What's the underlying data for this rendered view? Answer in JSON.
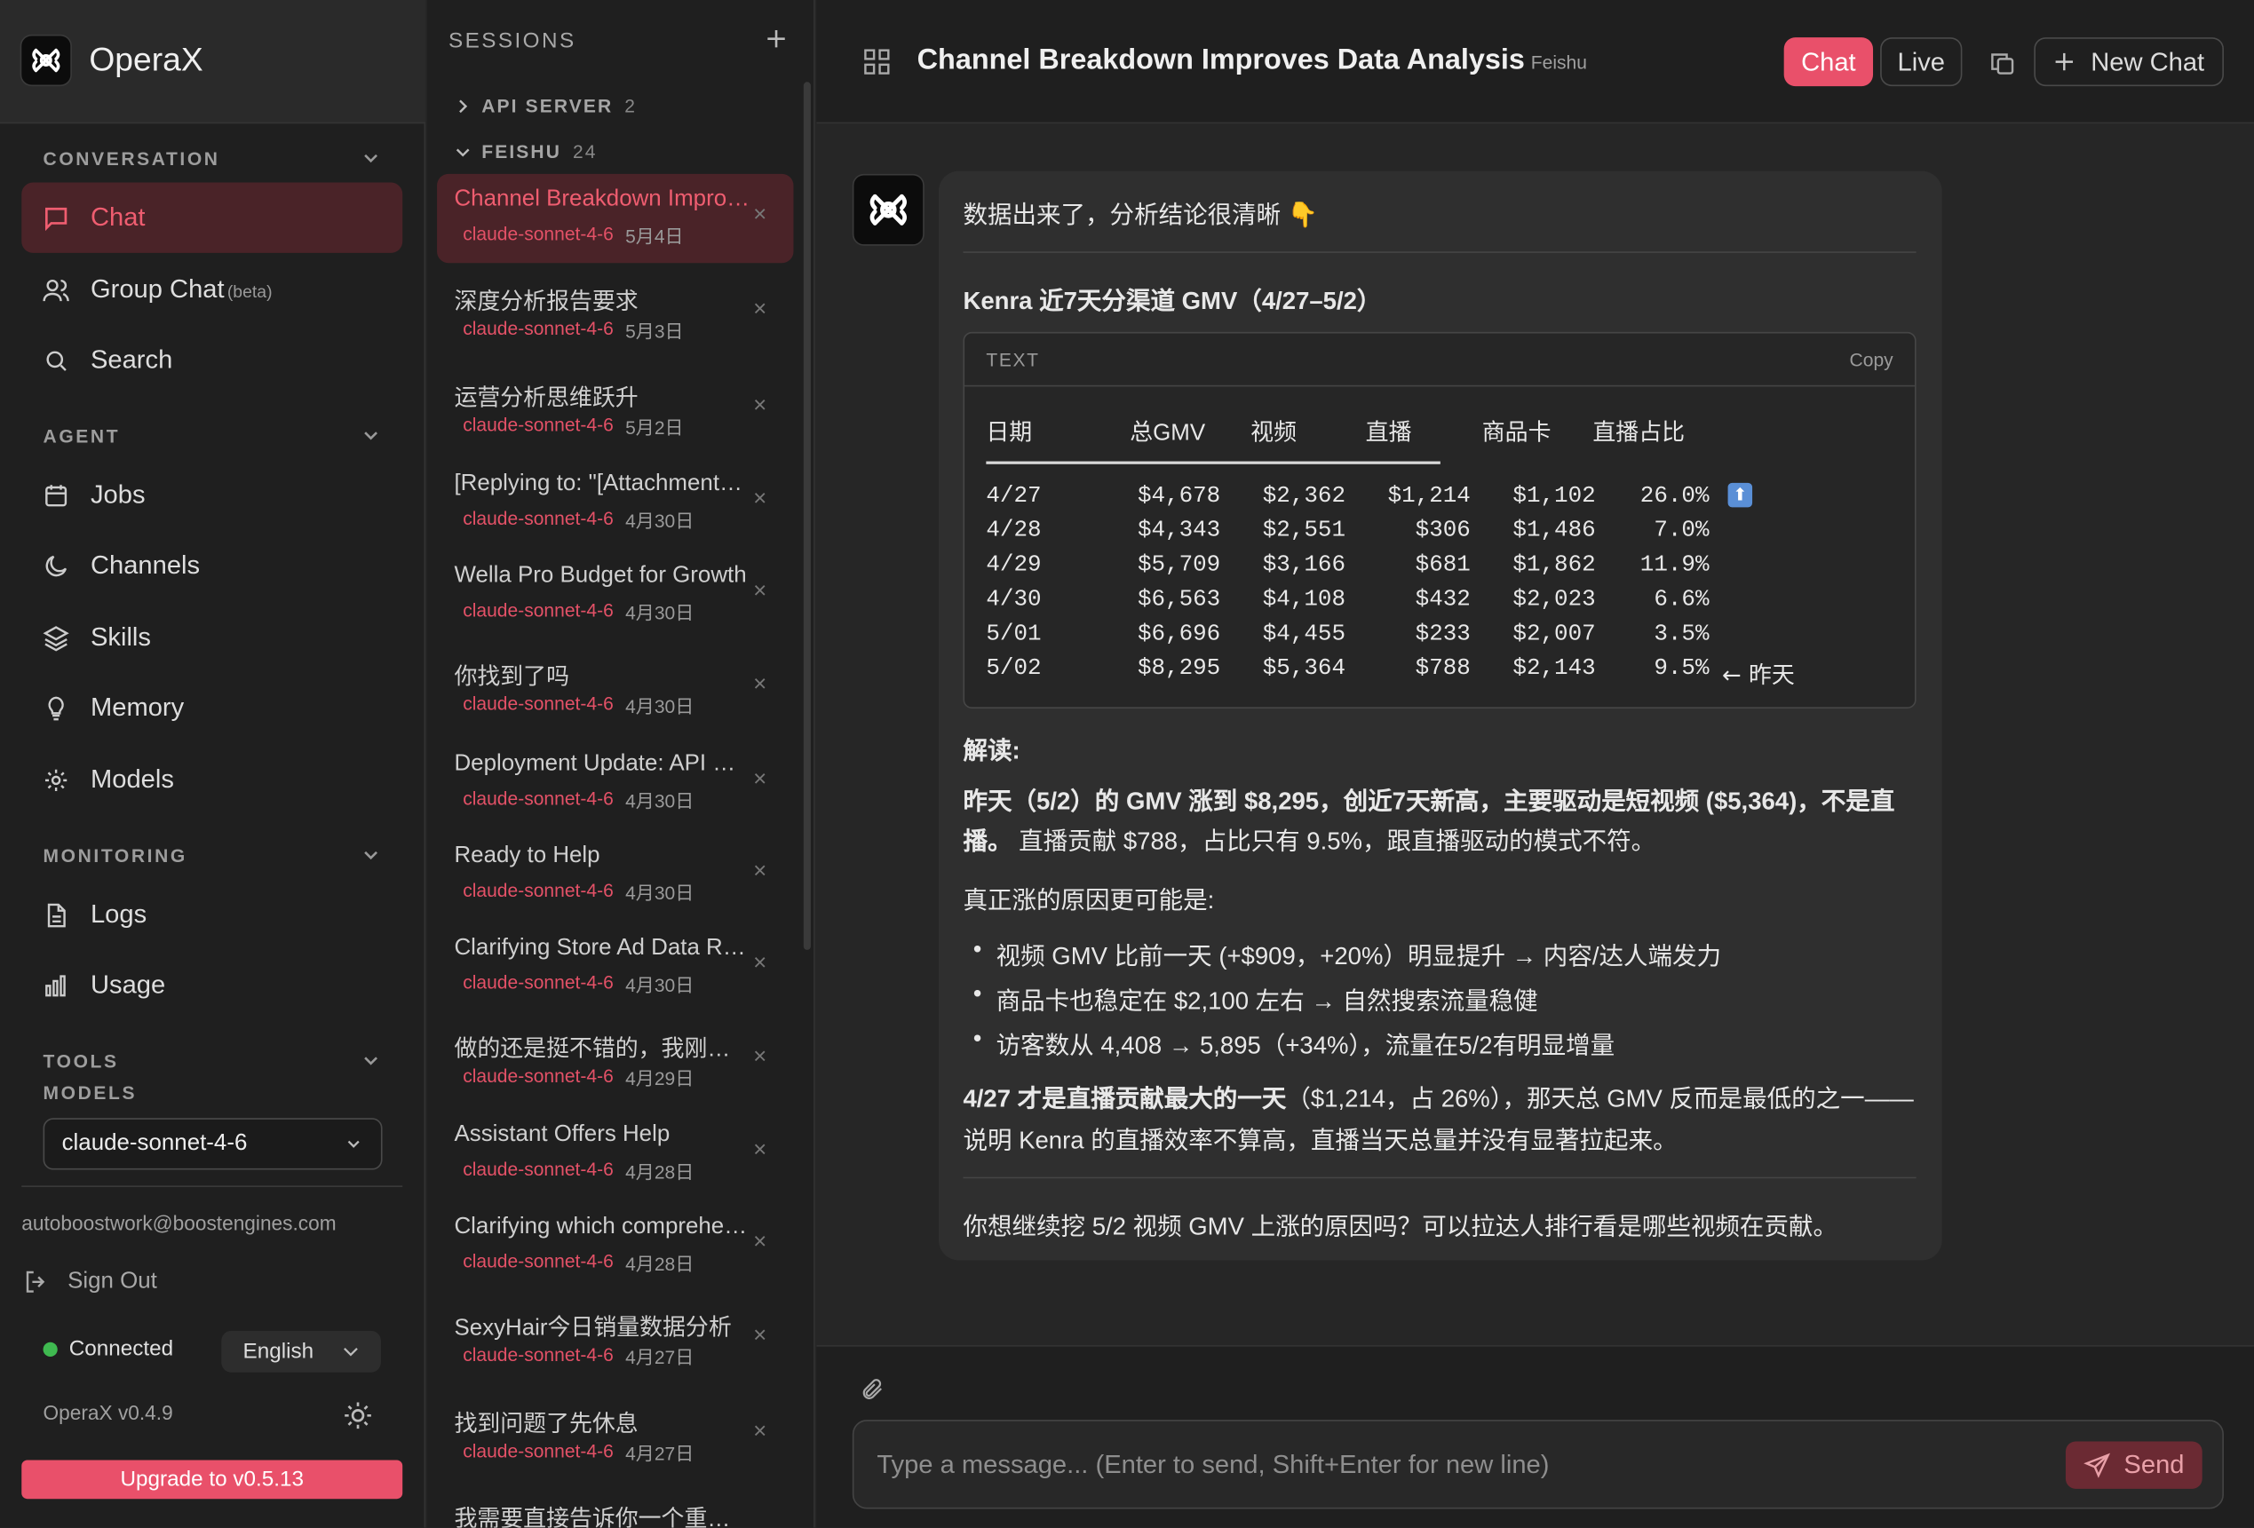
{
  "app": {
    "name": "OperaX",
    "version": "OperaX v0.4.9",
    "upgrade_label": "Upgrade to v0.5.13"
  },
  "sidebar": {
    "sections": {
      "conversation": "CONVERSATION",
      "agent": "AGENT",
      "monitoring": "MONITORING",
      "tools": "TOOLS",
      "models": "MODELS"
    },
    "items": [
      {
        "label": "Chat",
        "icon": "message-square-icon",
        "active": true
      },
      {
        "label": "Group Chat",
        "badge": "(beta)",
        "icon": "users-icon"
      },
      {
        "label": "Search",
        "icon": "search-icon"
      },
      {
        "label": "Jobs",
        "icon": "calendar-icon"
      },
      {
        "label": "Channels",
        "icon": "moon-icon"
      },
      {
        "label": "Skills",
        "icon": "layers-icon"
      },
      {
        "label": "Memory",
        "icon": "lightbulb-icon"
      },
      {
        "label": "Models",
        "icon": "sun-icon"
      },
      {
        "label": "Logs",
        "icon": "file-text-icon"
      },
      {
        "label": "Usage",
        "icon": "bar-chart-icon"
      }
    ],
    "model_select": "claude-sonnet-4-6",
    "email": "autoboostwork@boostengines.com",
    "sign_out": "Sign Out",
    "status": "Connected",
    "language": "English"
  },
  "sessions": {
    "title": "SESSIONS",
    "groups": [
      {
        "label": "API SERVER",
        "count": "2"
      },
      {
        "label": "FEISHU",
        "count": "24"
      }
    ],
    "items": [
      {
        "title": "Channel Breakdown Improves Data Analysis",
        "model": "claude-sonnet-4-6",
        "date": "5月4日",
        "active": true
      },
      {
        "title": "深度分析报告要求",
        "model": "claude-sonnet-4-6",
        "date": "5月3日"
      },
      {
        "title": "运营分析思维跃升",
        "model": "claude-sonnet-4-6",
        "date": "5月2日"
      },
      {
        "title": "[Replying to: \"[Attachment…",
        "model": "claude-sonnet-4-6",
        "date": "4月30日"
      },
      {
        "title": "Wella Pro Budget for Growth",
        "model": "claude-sonnet-4-6",
        "date": "4月30日"
      },
      {
        "title": "你找到了吗",
        "model": "claude-sonnet-4-6",
        "date": "4月30日"
      },
      {
        "title": "Deployment Update: API Server",
        "model": "claude-sonnet-4-6",
        "date": "4月30日"
      },
      {
        "title": "Ready to Help",
        "model": "claude-sonnet-4-6",
        "date": "4月30日"
      },
      {
        "title": "Clarifying Store Ad Data Requests",
        "model": "claude-sonnet-4-6",
        "date": "4月30日"
      },
      {
        "title": "做的还是挺不错的，我刚刚看了",
        "model": "claude-sonnet-4-6",
        "date": "4月29日"
      },
      {
        "title": "Assistant Offers Help",
        "model": "claude-sonnet-4-6",
        "date": "4月28日"
      },
      {
        "title": "Clarifying which comprehensive",
        "model": "claude-sonnet-4-6",
        "date": "4月28日"
      },
      {
        "title": "SexyHair今日销量数据分析",
        "model": "claude-sonnet-4-6",
        "date": "4月27日"
      },
      {
        "title": "找到问题了先休息",
        "model": "claude-sonnet-4-6",
        "date": "4月27日"
      },
      {
        "title": "我需要直接告诉你一个重要的",
        "model": "",
        "date": ""
      }
    ]
  },
  "header": {
    "title": "Channel Breakdown Improves Data Analysis",
    "source": "Feishu",
    "chat_label": "Chat",
    "live_label": "Live",
    "new_chat_label": "New Chat"
  },
  "message": {
    "intro": "数据出来了，分析结论很清晰 👇",
    "table_title": "Kenra 近7天分渠道 GMV（4/27–5/2）",
    "code_lang": "TEXT",
    "copy_label": "Copy",
    "columns": [
      "日期",
      "总GMV",
      "视频",
      "直播",
      "商品卡",
      "直播占比"
    ],
    "rows": [
      [
        "4/27",
        "$4,678",
        "$2,362",
        "$1,214",
        "$1,102",
        "26.0%",
        "⬆"
      ],
      [
        "4/28",
        "$4,343",
        "$2,551",
        "$306",
        "$1,486",
        "7.0%",
        ""
      ],
      [
        "4/29",
        "$5,709",
        "$3,166",
        "$681",
        "$1,862",
        "11.9%",
        ""
      ],
      [
        "4/30",
        "$6,563",
        "$4,108",
        "$432",
        "$2,023",
        "6.6%",
        ""
      ],
      [
        "5/01",
        "$6,696",
        "$4,455",
        "$233",
        "$2,007",
        "3.5%",
        ""
      ],
      [
        "5/02",
        "$8,295",
        "$5,364",
        "$788",
        "$2,143",
        "9.5%",
        "← 昨天"
      ]
    ],
    "reading_label": "解读:",
    "p1_bold": "昨天（5/2）的 GMV 涨到 $8,295，创近7天新高，主要驱动是短视频 ($5,364)，不是直播。",
    "p1_rest": " 直播贡献 $788，占比只有 9.5%，跟直播驱动的模式不符。",
    "p2": "真正涨的原因更可能是:",
    "bullets": [
      "视频 GMV 比前一天 (+$909，+20%）明显提升 → 内容/达人端发力",
      "商品卡也稳定在 $2,100 左右 → 自然搜索流量稳健",
      "访客数从 4,408 → 5,895（+34%），流量在5/2有明显增量"
    ],
    "p3_bold": "4/27 才是直播贡献最大的一天",
    "p3_rest": "（$1,214，占 26%），那天总 GMV 反而是最低的之一——说明 Kenra 的直播效率不算高，直播当天总量并没有显著拉起来。",
    "question": "你想继续挖 5/2 视频 GMV 上涨的原因吗？可以拉达人排行看是哪些视频在贡献。"
  },
  "composer": {
    "placeholder": "Type a message... (Enter to send, Shift+Enter for new line)",
    "send_label": "Send"
  },
  "colors": {
    "accent": "#e9506a",
    "sidebar_bg": "#1f1f1f",
    "main_bg": "#262626",
    "bubble_bg": "#2f2f2f"
  }
}
